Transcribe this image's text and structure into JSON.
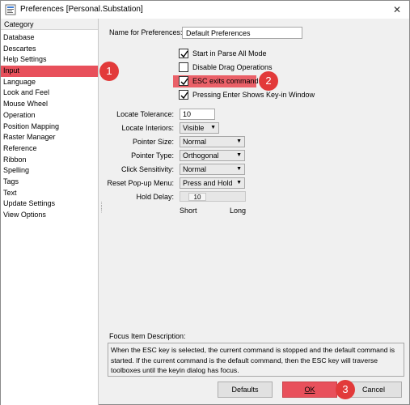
{
  "window": {
    "title": "Preferences [Personal.Substation]",
    "close_glyph": "✕"
  },
  "category": {
    "header": "Category",
    "items": [
      "Database",
      "Descartes",
      "Help Settings",
      "Input",
      "Language",
      "Look and Feel",
      "Mouse Wheel",
      "Operation",
      "Position Mapping",
      "Raster Manager",
      "Reference",
      "Ribbon",
      "Spelling",
      "Tags",
      "Text",
      "Update Settings",
      "View Options"
    ],
    "selected_index": 3
  },
  "main": {
    "name_label": "Name for Preferences:",
    "name_value": "Default Preferences",
    "checkboxes": [
      {
        "label": "Start in Parse All Mode",
        "checked": true
      },
      {
        "label": "Disable Drag Operations",
        "checked": false
      },
      {
        "label": "ESC exits command",
        "checked": true
      },
      {
        "label": "Pressing Enter Shows Key-in Window",
        "checked": true
      }
    ],
    "locate_tolerance_label": "Locate Tolerance:",
    "locate_tolerance_value": "10",
    "locate_interiors_label": "Locate Interiors:",
    "locate_interiors_value": "Visible",
    "pointer_size_label": "Pointer Size:",
    "pointer_size_value": "Normal",
    "pointer_type_label": "Pointer Type:",
    "pointer_type_value": "Orthogonal",
    "click_sensitivity_label": "Click Sensitivity:",
    "click_sensitivity_value": "Normal",
    "reset_popup_label": "Reset Pop-up Menu:",
    "reset_popup_value": "Press and Hold",
    "hold_delay_label": "Hold Delay:",
    "hold_delay_value": "10",
    "hold_delay_min": "Short",
    "hold_delay_max": "Long",
    "focus_label": "Focus Item Description:",
    "focus_text": "When the ESC key is selected, the current command is stopped and the default command is started.  If the current command is the default command, then the ESC key will traverse toolboxes until the keyin dialog has focus."
  },
  "buttons": {
    "defaults": "Defaults",
    "ok": "OK",
    "cancel": "Cancel"
  },
  "markers": [
    "1",
    "2",
    "3"
  ],
  "colors": {
    "highlight": "#e8505b",
    "marker": "#e23a3a"
  }
}
